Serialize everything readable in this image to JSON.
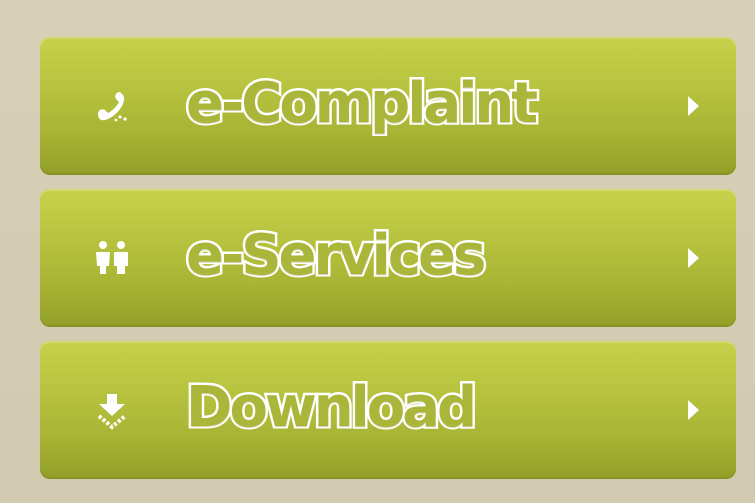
{
  "menu": {
    "items": [
      {
        "label": "e-Complaint",
        "icon": "phone-icon"
      },
      {
        "label": "e-Services",
        "icon": "people-icon"
      },
      {
        "label": "Download",
        "icon": "download-icon"
      }
    ]
  },
  "colors": {
    "background": "#d8d0b6",
    "button_top": "#c6d24a",
    "button_bottom": "#929f28",
    "text_outline": "#ffffff"
  }
}
